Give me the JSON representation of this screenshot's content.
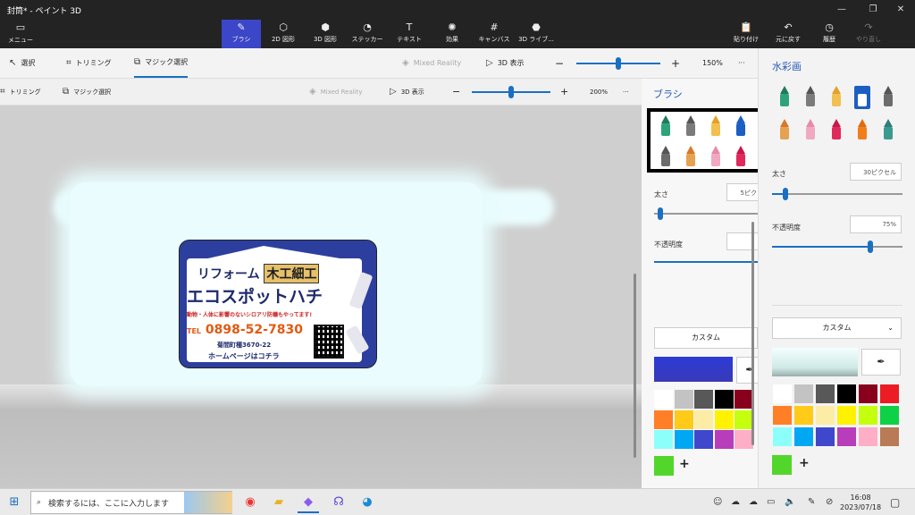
{
  "window": {
    "title": "封筒* - ペイント 3D",
    "minimize_icon": "minimize-icon",
    "maximize_icon": "maximize-icon",
    "close_icon": "close-icon"
  },
  "menu": {
    "label": "メニュー"
  },
  "commands": [
    {
      "label": "ブラシ",
      "icon": "brush-icon",
      "glyph": "✎",
      "active": true
    },
    {
      "label": "2D 図形",
      "icon": "2d-shapes-icon",
      "glyph": "⬡"
    },
    {
      "label": "3D 図形",
      "icon": "3d-shapes-icon",
      "glyph": "⬢"
    },
    {
      "label": "ステッカー",
      "icon": "sticker-icon",
      "glyph": "◔"
    },
    {
      "label": "テキスト",
      "icon": "text-icon",
      "glyph": "T"
    },
    {
      "label": "効果",
      "icon": "effects-icon",
      "glyph": "✺"
    },
    {
      "label": "キャンバス",
      "icon": "canvas-icon",
      "glyph": "#"
    },
    {
      "label": "3D ライブ...",
      "icon": "3d-library-icon",
      "glyph": "⬣"
    }
  ],
  "right_commands": [
    {
      "label": "貼り付け",
      "icon": "paste-icon",
      "glyph": "📋"
    },
    {
      "label": "元に戻す",
      "icon": "undo-icon",
      "glyph": "↶"
    },
    {
      "label": "履歴",
      "icon": "history-icon",
      "glyph": "◷"
    },
    {
      "label": "やり直し",
      "icon": "redo-icon",
      "glyph": "↷",
      "disabled": true
    }
  ],
  "toolbar_outer": {
    "select": "選択",
    "trim": "トリミング",
    "magic_select": "マジック選択",
    "mixed_reality": "Mixed Reality",
    "view_3d": "3D 表示",
    "zoom_out": "−",
    "zoom_in": "+",
    "zoom": "150%",
    "more": "···",
    "zoom_fraction": 0.5
  },
  "toolbar_inner": {
    "trim": "トリミング",
    "magic_select": "マジック選択",
    "mixed_reality": "Mixed Reality",
    "view_3d": "3D 表示",
    "zoom_out": "−",
    "zoom_in": "+",
    "zoom": "200%",
    "more": "···",
    "zoom_fraction": 0.5
  },
  "card": {
    "line1_a": "リフォーム",
    "line1_b": "木工細工",
    "line2": "エコスポットハチ",
    "line3": "動物・人体に影響のないシロアリ防蟻もやってます!",
    "tel_prefix": "TEL",
    "tel": "0898-52-7830",
    "address": "菊間町種3670-22",
    "homepage": "ホームページはコチラ"
  },
  "inner_panel": {
    "title": "ブラシ",
    "thickness_label": "太さ",
    "thickness_value": "5ピク",
    "opacity_label": "不透明度",
    "custom": "カスタム",
    "add": "+"
  },
  "right_panel": {
    "title": "水彩画",
    "thickness_label": "太さ",
    "thickness_value": "30ピクセル",
    "thickness_fraction": 0.1,
    "opacity_label": "不透明度",
    "opacity_value": "75%",
    "opacity_fraction": 0.75,
    "custom": "カスタム",
    "add": "+",
    "current_color": "#53d62b"
  },
  "brushes": [
    {
      "name": "marker-brush",
      "tip": "#1f7a5c",
      "body": "#2ea37a"
    },
    {
      "name": "calligraphy-pen-brush",
      "tip": "#555",
      "body": "#7b7b7b"
    },
    {
      "name": "oil-brush",
      "tip": "#e3a126",
      "body": "#f2c050"
    },
    {
      "name": "watercolor-brush",
      "tip": "#1b5fc2",
      "body": "#1b5fc2",
      "selected": true
    },
    {
      "name": "pixel-pen-brush",
      "tip": "#555",
      "body": "#6c6c6c"
    },
    {
      "name": "pencil-brush",
      "tip": "#d7782b",
      "body": "#e5a253"
    },
    {
      "name": "eraser-brush",
      "tip": "#e88aa7",
      "body": "#f0a9c0"
    },
    {
      "name": "crayon-brush",
      "tip": "#c8184a",
      "body": "#e02a5c"
    },
    {
      "name": "spray-can-brush",
      "tip": "#e06a10",
      "body": "#f27d1b"
    },
    {
      "name": "fill-bucket-brush",
      "tip": "#2e7e77",
      "body": "#3a9a8f"
    }
  ],
  "palette": [
    "#ffffff",
    "#c3c3c3",
    "#585858",
    "#000000",
    "#88001b",
    "#ec1c24",
    "#ff7f27",
    "#ffca18",
    "#fdeca6",
    "#fff200",
    "#c4ff0e",
    "#0ed145",
    "#8cfffb",
    "#00a8f3",
    "#3f48cc",
    "#b83dba",
    "#ffaec8",
    "#b97a56"
  ],
  "taskbar": {
    "search_placeholder": "検索するには、ここに入力します",
    "time": "16:08",
    "date": "2023/07/18"
  }
}
